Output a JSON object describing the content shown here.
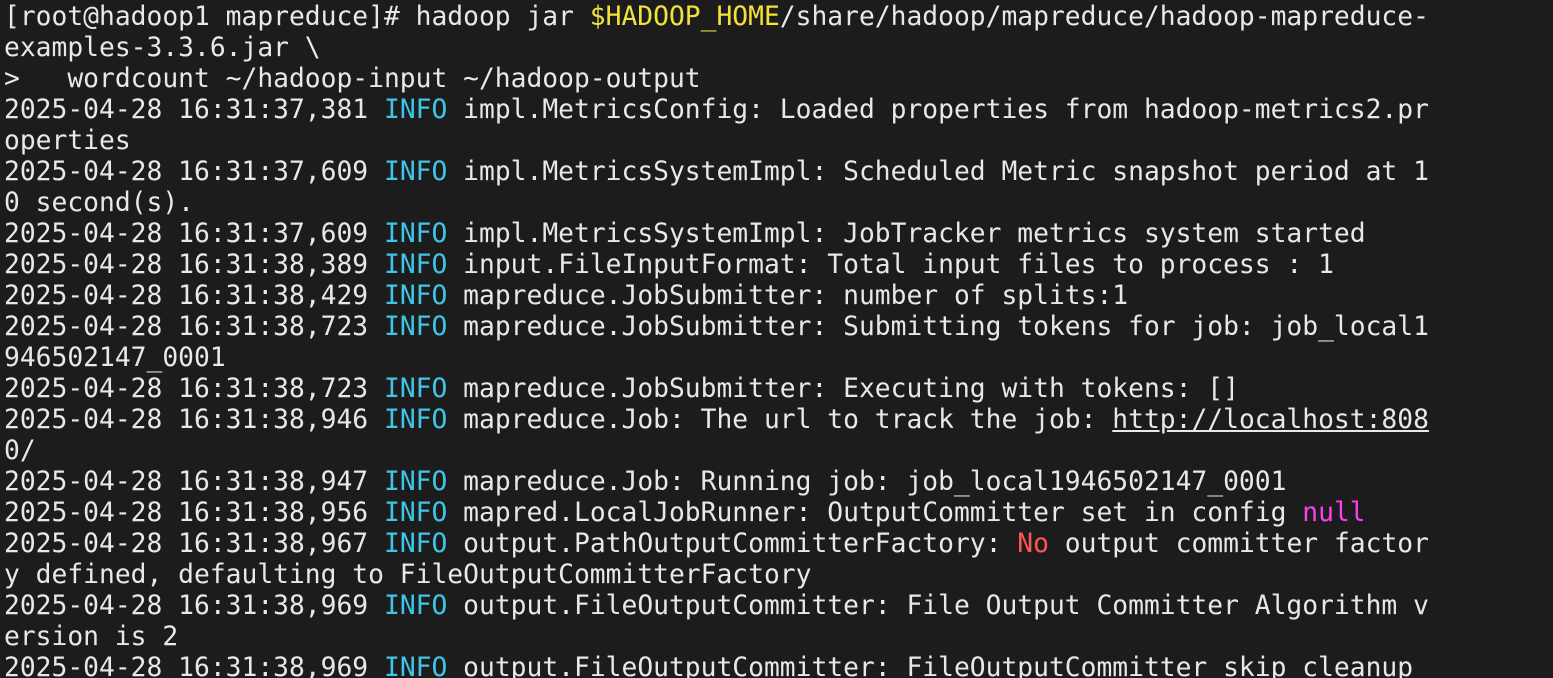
{
  "colors": {
    "background": "#1c1c1c",
    "text": "#e8e8e8",
    "info": "#3fc5e8",
    "env_var": "#f4e23a",
    "null_keyword": "#ff3df0",
    "no_keyword": "#ff5555"
  },
  "lines": [
    [
      {
        "t": "[root@hadoop1 mapreduce]# hadoop jar "
      },
      {
        "t": "$HADOOP_HOME",
        "c": "env"
      },
      {
        "t": "/share/hadoop/mapreduce/hadoop-mapreduce-"
      }
    ],
    [
      {
        "t": "examples-3.3.6.jar \\"
      }
    ],
    [
      {
        "t": ">   wordcount ~/hadoop-input ~/hadoop-output"
      }
    ],
    [
      {
        "t": "2025-04-28 16:31:37,381 "
      },
      {
        "t": "INFO",
        "c": "info"
      },
      {
        "t": " impl.MetricsConfig: Loaded properties from hadoop-metrics2.pr"
      }
    ],
    [
      {
        "t": "operties"
      }
    ],
    [
      {
        "t": "2025-04-28 16:31:37,609 "
      },
      {
        "t": "INFO",
        "c": "info"
      },
      {
        "t": " impl.MetricsSystemImpl: Scheduled Metric snapshot period at 1"
      }
    ],
    [
      {
        "t": "0 second(s)."
      }
    ],
    [
      {
        "t": "2025-04-28 16:31:37,609 "
      },
      {
        "t": "INFO",
        "c": "info"
      },
      {
        "t": " impl.MetricsSystemImpl: JobTracker metrics system started"
      }
    ],
    [
      {
        "t": "2025-04-28 16:31:38,389 "
      },
      {
        "t": "INFO",
        "c": "info"
      },
      {
        "t": " input.FileInputFormat: Total input files to process : 1"
      }
    ],
    [
      {
        "t": "2025-04-28 16:31:38,429 "
      },
      {
        "t": "INFO",
        "c": "info"
      },
      {
        "t": " mapreduce.JobSubmitter: number of splits:1"
      }
    ],
    [
      {
        "t": "2025-04-28 16:31:38,723 "
      },
      {
        "t": "INFO",
        "c": "info"
      },
      {
        "t": " mapreduce.JobSubmitter: Submitting tokens for job: job_local1"
      }
    ],
    [
      {
        "t": "946502147_0001"
      }
    ],
    [
      {
        "t": "2025-04-28 16:31:38,723 "
      },
      {
        "t": "INFO",
        "c": "info"
      },
      {
        "t": " mapreduce.JobSubmitter: Executing with tokens: []"
      }
    ],
    [
      {
        "t": "2025-04-28 16:31:38,946 "
      },
      {
        "t": "INFO",
        "c": "info"
      },
      {
        "t": " mapreduce.Job: The url to track the job: "
      },
      {
        "t": "http://localhost:808",
        "c": "link"
      }
    ],
    [
      {
        "t": "0/",
        "c": "link-tail"
      }
    ],
    [
      {
        "t": "2025-04-28 16:31:38,947 "
      },
      {
        "t": "INFO",
        "c": "info"
      },
      {
        "t": " mapreduce.Job: Running job: job_local1946502147_0001"
      }
    ],
    [
      {
        "t": "2025-04-28 16:31:38,956 "
      },
      {
        "t": "INFO",
        "c": "info"
      },
      {
        "t": " mapred.LocalJobRunner: OutputCommitter set in config "
      },
      {
        "t": "null",
        "c": "null"
      }
    ],
    [
      {
        "t": "2025-04-28 16:31:38,967 "
      },
      {
        "t": "INFO",
        "c": "info"
      },
      {
        "t": " output.PathOutputCommitterFactory: "
      },
      {
        "t": "No",
        "c": "no"
      },
      {
        "t": " output committer factor"
      }
    ],
    [
      {
        "t": "y defined, defaulting to FileOutputCommitterFactory"
      }
    ],
    [
      {
        "t": "2025-04-28 16:31:38,969 "
      },
      {
        "t": "INFO",
        "c": "info"
      },
      {
        "t": " output.FileOutputCommitter: File Output Committer Algorithm v"
      }
    ],
    [
      {
        "t": "ersion is 2"
      }
    ],
    [
      {
        "t": "2025-04-28 16:31:38,969 "
      },
      {
        "t": "INFO",
        "c": "info"
      },
      {
        "t": " output.FileOutputCommitter: FileOutputCommitter skip cleanup"
      }
    ]
  ]
}
